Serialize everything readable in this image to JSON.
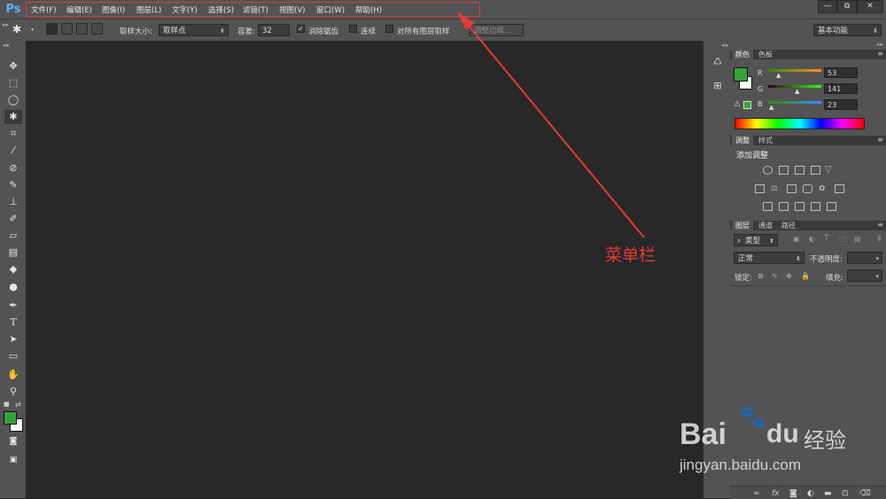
{
  "app": {
    "logo": "Ps"
  },
  "menu": {
    "items": [
      "文件(F)",
      "编辑(E)",
      "图像(I)",
      "图层(L)",
      "文字(Y)",
      "选择(S)",
      "滤镜(T)",
      "视图(V)",
      "窗口(W)",
      "帮助(H)"
    ],
    "highlight_color": "#e0393e"
  },
  "window_controls": {
    "minimize": "—",
    "restore": "⧉",
    "close": "✕"
  },
  "options_bar": {
    "sample_size_label": "取样大小:",
    "sample_size_value": "取样点",
    "tolerance_label": "容差:",
    "tolerance_value": "32",
    "antialias_label": "消除锯齿",
    "antialias_checked": true,
    "contiguous_label": "连续",
    "contiguous_checked": false,
    "all_layers_label": "对所有图层取样",
    "all_layers_checked": false,
    "refine_edge_label": "调整边缘...",
    "workspace_value": "基本功能"
  },
  "toolbar": {
    "tools": [
      "move-icon",
      "marquee-icon",
      "lasso-icon",
      "magic-wand-icon",
      "crop-icon",
      "eyedropper-icon",
      "healing-brush-icon",
      "brush-icon",
      "clone-stamp-icon",
      "history-brush-icon",
      "eraser-icon",
      "gradient-icon",
      "blur-icon",
      "dodge-icon",
      "pen-icon",
      "type-icon",
      "path-selection-icon",
      "rectangle-icon",
      "hand-icon",
      "zoom-icon"
    ],
    "foreground_color": "#35a33b",
    "background_color": "#ffffff"
  },
  "color_panel": {
    "tabs": [
      "颜色",
      "色板"
    ],
    "channels": [
      {
        "name": "R",
        "value": "53"
      },
      {
        "name": "G",
        "value": "141"
      },
      {
        "name": "B",
        "value": "23"
      }
    ]
  },
  "adjustments_panel": {
    "tabs": [
      "调整",
      "样式"
    ],
    "title": "添加调整"
  },
  "layers_panel": {
    "tabs": [
      "图层",
      "通道",
      "路径"
    ],
    "filter_label": "类型",
    "blend_mode": "正常",
    "opacity_label": "不透明度:",
    "lock_label": "锁定:",
    "fill_label": "填充:"
  },
  "annotation": {
    "label": "菜单栏",
    "color": "#e33a3a"
  },
  "watermark": {
    "brand": "Bai",
    "brand2": "du",
    "product": "经验",
    "url": "jingyan.baidu.com"
  }
}
